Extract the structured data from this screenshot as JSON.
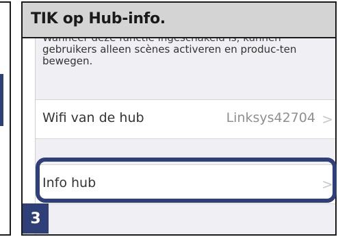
{
  "header": {
    "title": "TIK op Hub-info."
  },
  "screen": {
    "description_clipped_line": "Wanneer deze functie ingeschakeld is, kunnen",
    "description": "gebruikers alleen scènes activeren en produc-ten bewegen.",
    "wifi_row": {
      "label": "Wifi van de hub",
      "value": "Linksys42704",
      "chevron": ">"
    },
    "info_row": {
      "label": "Info hub",
      "chevron": ">"
    }
  },
  "step": {
    "number": "3"
  },
  "colors": {
    "accent": "#2f3f78",
    "header_bg": "#d4d4d4",
    "screen_bg": "#efeff4"
  }
}
